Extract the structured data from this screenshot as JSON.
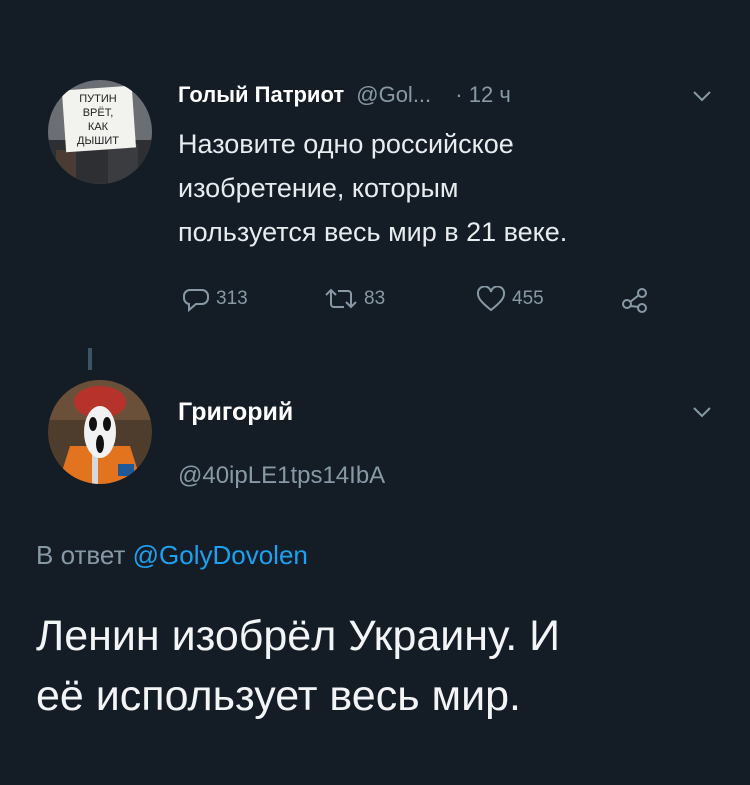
{
  "tweet": {
    "author_name": "Голый Патриот",
    "author_handle": "@Gol...",
    "separator": "·",
    "time": "12 ч",
    "avatar_sign_text": [
      "ПУТИН",
      "ВРЁТ,",
      "КАК",
      "ДЫШИТ"
    ],
    "text_lines": [
      "Назовите одно российское",
      "изобретение, которым",
      "пользуется весь мир в 21 веке."
    ],
    "replies": "313",
    "retweets": "83",
    "likes": "455"
  },
  "reply": {
    "author_name": "Григорий",
    "author_handle": "@40ipLE1tps14IbA",
    "reply_prefix": "В ответ",
    "reply_to": "@GolyDovolen",
    "text_lines": [
      "Ленин изобрёл Украину. И",
      "её использует весь мир."
    ]
  },
  "colors": {
    "background": "#141d26",
    "muted": "#8899a6",
    "link": "#1da1f2",
    "text": "#e8ecef"
  },
  "icons": [
    "reply-icon",
    "retweet-icon",
    "like-icon",
    "share-icon",
    "chevron-down-icon"
  ]
}
